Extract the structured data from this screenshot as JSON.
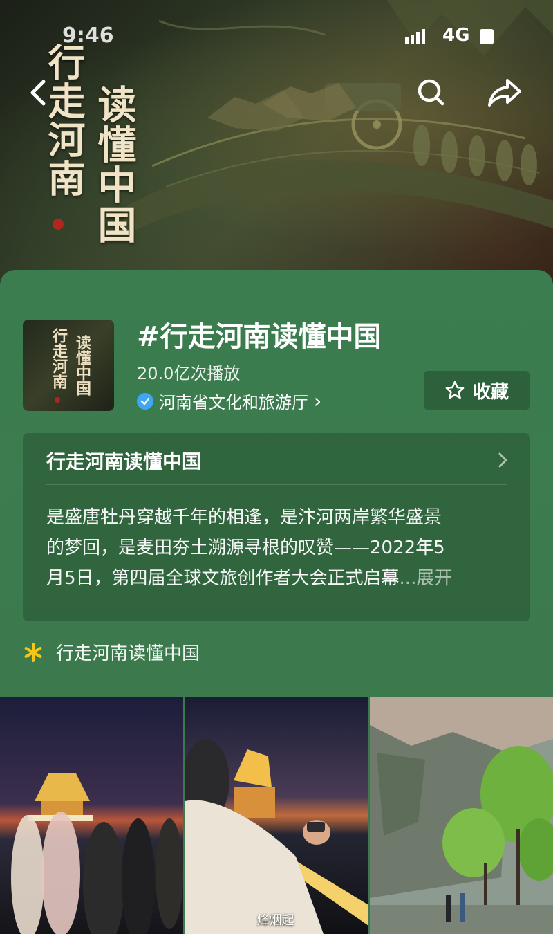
{
  "status_bar": {
    "time": "9:46",
    "network": "4G"
  },
  "header": {
    "back_icon": "chevron-left-icon",
    "search_icon": "search-icon",
    "share_icon": "share-arrow-icon"
  },
  "banner": {
    "calligraphy_left": "行走河南",
    "calligraphy_right": "读懂中国"
  },
  "topic": {
    "title": "#行走河南读懂中国",
    "plays": "20.0亿次播放",
    "owner": "河南省文化和旅游厅",
    "owner_chevron": "›",
    "collect_label": "收藏"
  },
  "card": {
    "heading": "行走河南读懂中国",
    "lines": [
      "是盛唐牡丹穿越千年的相逢，是汴河两岸繁华盛景",
      "的梦回，是麦田夯土溯源寻根的叹赞——2022年5",
      "月5日，第四届全球文旅创作者大会正式启幕"
    ],
    "ellipsis": "...",
    "more_label": "展开"
  },
  "tag": {
    "icon": "asterisk-icon",
    "label": "行走河南读懂中国"
  },
  "videos": [
    {
      "caption": ""
    },
    {
      "caption": "烽烟起"
    },
    {
      "caption": ""
    }
  ],
  "colors": {
    "panel_green": "#3c7a4e",
    "verified_blue": "#3ea6f2",
    "tag_yellow": "#f5c518",
    "seal_red": "#b4261d"
  }
}
